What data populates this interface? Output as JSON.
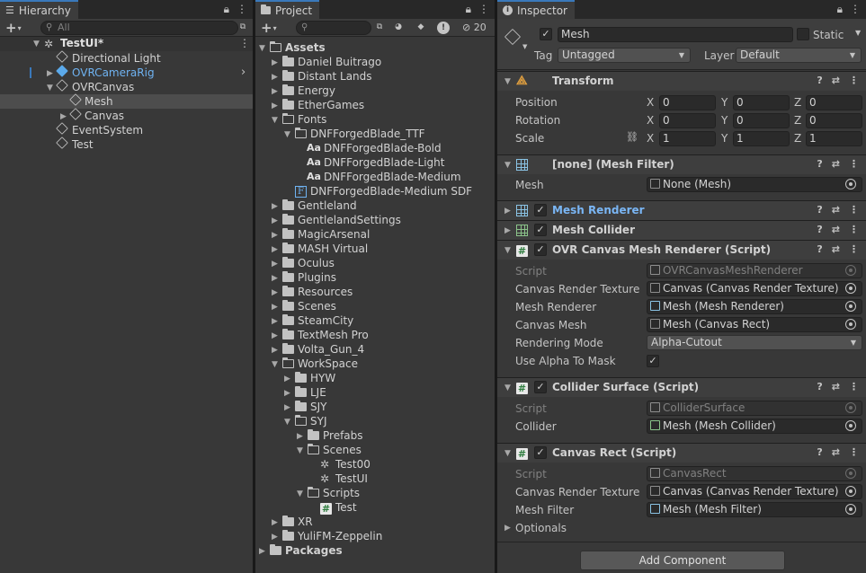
{
  "hierarchy": {
    "tab_label": "Hierarchy",
    "search_placeholder": "All",
    "scene_name": "TestUI*",
    "items": [
      {
        "label": "Directional Light"
      },
      {
        "label": "OVRCameraRig"
      },
      {
        "label": "OVRCanvas"
      },
      {
        "label": "Mesh"
      },
      {
        "label": "Canvas"
      },
      {
        "label": "EventSystem"
      },
      {
        "label": "Test"
      }
    ]
  },
  "project": {
    "tab_label": "Project",
    "hidden_count": "20",
    "assets_label": "Assets",
    "packages_label": "Packages",
    "items": [
      {
        "label": "Daniel Buitrago"
      },
      {
        "label": "Distant Lands"
      },
      {
        "label": "Energy"
      },
      {
        "label": "EtherGames"
      },
      {
        "label": "Fonts"
      },
      {
        "label": "DNFForgedBlade_TTF"
      },
      {
        "label": "DNFForgedBlade-Bold"
      },
      {
        "label": "DNFForgedBlade-Light"
      },
      {
        "label": "DNFForgedBlade-Medium"
      },
      {
        "label": "DNFForgedBlade-Medium SDF"
      },
      {
        "label": "Gentleland"
      },
      {
        "label": "GentlelandSettings"
      },
      {
        "label": "MagicArsenal"
      },
      {
        "label": "MASH Virtual"
      },
      {
        "label": "Oculus"
      },
      {
        "label": "Plugins"
      },
      {
        "label": "Resources"
      },
      {
        "label": "Scenes"
      },
      {
        "label": "SteamCity"
      },
      {
        "label": "TextMesh Pro"
      },
      {
        "label": "Volta_Gun_4"
      },
      {
        "label": "WorkSpace"
      },
      {
        "label": "HYW"
      },
      {
        "label": "LJE"
      },
      {
        "label": "SJY"
      },
      {
        "label": "SYJ"
      },
      {
        "label": "Prefabs"
      },
      {
        "label": "Scenes"
      },
      {
        "label": "Test00"
      },
      {
        "label": "TestUI"
      },
      {
        "label": "Scripts"
      },
      {
        "label": "Test"
      },
      {
        "label": "XR"
      },
      {
        "label": "YuliFM-Zeppelin"
      }
    ]
  },
  "inspector": {
    "tab_label": "Inspector",
    "object_name": "Mesh",
    "static_label": "Static",
    "tag_label": "Tag",
    "tag_value": "Untagged",
    "layer_label": "Layer",
    "layer_value": "Default",
    "transform": {
      "title": "Transform",
      "position_label": "Position",
      "rotation_label": "Rotation",
      "scale_label": "Scale",
      "x": "X",
      "y": "Y",
      "z": "Z",
      "position": [
        "0",
        "0",
        "0"
      ],
      "rotation": [
        "0",
        "0",
        "0"
      ],
      "scale": [
        "1",
        "1",
        "1"
      ]
    },
    "mesh_filter": {
      "title": "[none] (Mesh Filter)",
      "mesh_label": "Mesh",
      "mesh_value": "None (Mesh)"
    },
    "mesh_renderer": {
      "title": "Mesh Renderer"
    },
    "mesh_collider": {
      "title": "Mesh Collider"
    },
    "ovr_canvas": {
      "title": "OVR Canvas Mesh Renderer (Script)",
      "script_label": "Script",
      "script_value": "OVRCanvasMeshRenderer",
      "crt_label": "Canvas Render Texture",
      "crt_value": "Canvas (Canvas Render Texture)",
      "mr_label": "Mesh Renderer",
      "mr_value": "Mesh (Mesh Renderer)",
      "cm_label": "Canvas Mesh",
      "cm_value": "Mesh (Canvas Rect)",
      "rm_label": "Rendering Mode",
      "rm_value": "Alpha-Cutout",
      "alpha_label": "Use Alpha To Mask"
    },
    "collider_surface": {
      "title": "Collider Surface (Script)",
      "script_label": "Script",
      "script_value": "ColliderSurface",
      "collider_label": "Collider",
      "collider_value": "Mesh (Mesh Collider)"
    },
    "canvas_rect": {
      "title": "Canvas Rect (Script)",
      "script_label": "Script",
      "script_value": "CanvasRect",
      "crt_label": "Canvas Render Texture",
      "crt_value": "Canvas (Canvas Render Texture)",
      "mf_label": "Mesh Filter",
      "mf_value": "Mesh (Mesh Filter)",
      "optionals_label": "Optionals"
    },
    "add_component_label": "Add Component"
  }
}
